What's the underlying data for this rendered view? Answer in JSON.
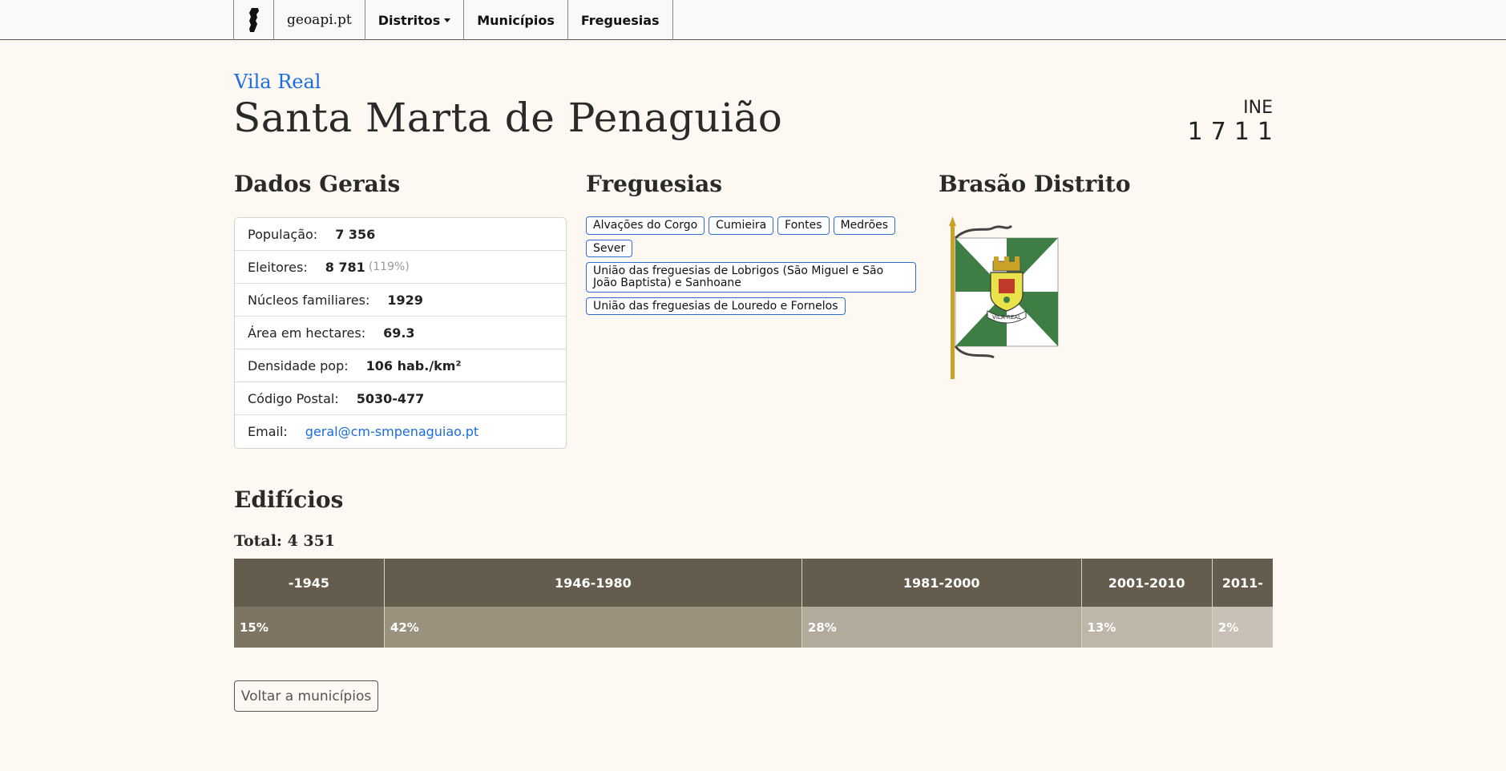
{
  "nav": {
    "brand": "geoapi.pt",
    "districts": "Distritos",
    "municipalities": "Municípios",
    "parishes": "Freguesias"
  },
  "header": {
    "district": "Vila Real",
    "title": "Santa Marta de Penaguião",
    "ine_label": "INE",
    "ine_code": "1711"
  },
  "sections": {
    "general": "Dados Gerais",
    "parishes": "Freguesias",
    "coat": "Brasão Distrito",
    "buildings": "Edifícios"
  },
  "general": [
    {
      "label": "População:",
      "value": "7 356"
    },
    {
      "label": "Eleitores:",
      "value": "8 781",
      "extra": "(119%)"
    },
    {
      "label": "Núcleos familiares:",
      "value": "1929"
    },
    {
      "label": "Área em hectares:",
      "value": "69.3"
    },
    {
      "label": "Densidade pop:",
      "value": "106 hab./km²"
    },
    {
      "label": "Código Postal:",
      "value": "5030-477"
    },
    {
      "label": "Email:",
      "value": "geral@cm-smpenaguiao.pt"
    }
  ],
  "parishes": [
    "Alvações do Corgo",
    "Cumieira",
    "Fontes",
    "Medrões",
    "Sever",
    "União das freguesias de Lobrigos (São Miguel e São João Baptista) e Sanhoane",
    "União das freguesias de Louredo e Fornelos"
  ],
  "coat_text": "VILA REAL",
  "buildings": {
    "total": "Total: 4 351",
    "columns": [
      {
        "period": "-1945",
        "pct_label": "15%",
        "pct": 14.5,
        "color": "#7d7462"
      },
      {
        "period": "1946-1980",
        "pct_label": "42%",
        "pct": 40.2,
        "color": "#9b927e"
      },
      {
        "period": "1981-2000",
        "pct_label": "28%",
        "pct": 26.9,
        "color": "#b2aa9b"
      },
      {
        "period": "2001-2010",
        "pct_label": "13%",
        "pct": 12.6,
        "color": "#bdb6a9"
      },
      {
        "period": "2011-",
        "pct_label": "2%",
        "pct": 5.8,
        "color": "#c8c2b6"
      }
    ]
  },
  "back_button": "Voltar a municípios"
}
